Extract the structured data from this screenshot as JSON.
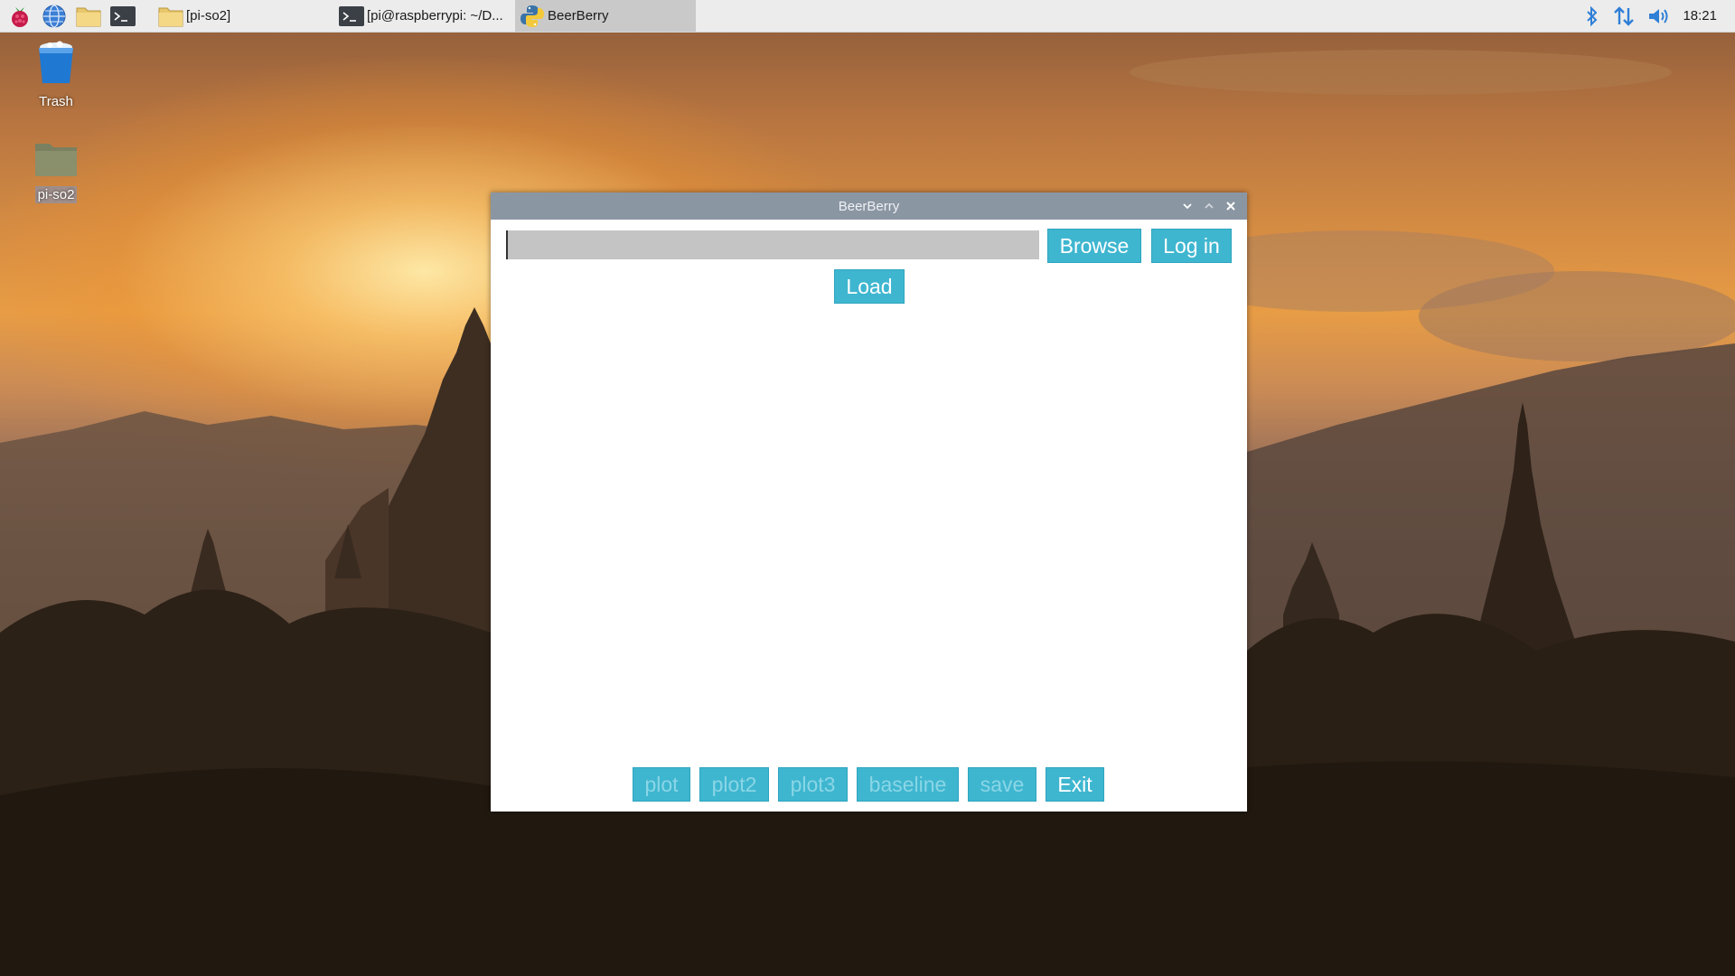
{
  "taskbar": {
    "launchers": [
      "raspberry-menu-icon",
      "web-browser-icon",
      "file-manager-icon",
      "terminal-icon"
    ],
    "tasks": [
      {
        "label": "[pi-so2]",
        "icon": "folder-icon"
      },
      {
        "label": "[pi@raspberrypi: ~/D...",
        "icon": "terminal-icon"
      },
      {
        "label": "BeerBerry",
        "icon": "python-icon"
      }
    ],
    "clock": "18:21",
    "tray": [
      "bluetooth-icon",
      "network-icon",
      "volume-icon"
    ]
  },
  "desktop": {
    "icons": [
      {
        "label": "Trash",
        "icon": "trash-icon"
      },
      {
        "label": "pi-so2",
        "icon": "folder-icon"
      }
    ]
  },
  "window": {
    "title": "BeerBerry",
    "file_input": {
      "value": "",
      "placeholder": ""
    },
    "buttons": {
      "browse": "Browse",
      "login": "Log in",
      "load": "Load",
      "plot": "plot",
      "plot2": "plot2",
      "plot3": "plot3",
      "baseline": "baseline",
      "save": "save",
      "exit": "Exit"
    },
    "colors": {
      "button": "#3fb6d0",
      "titlebar": "#8b96a3"
    }
  }
}
